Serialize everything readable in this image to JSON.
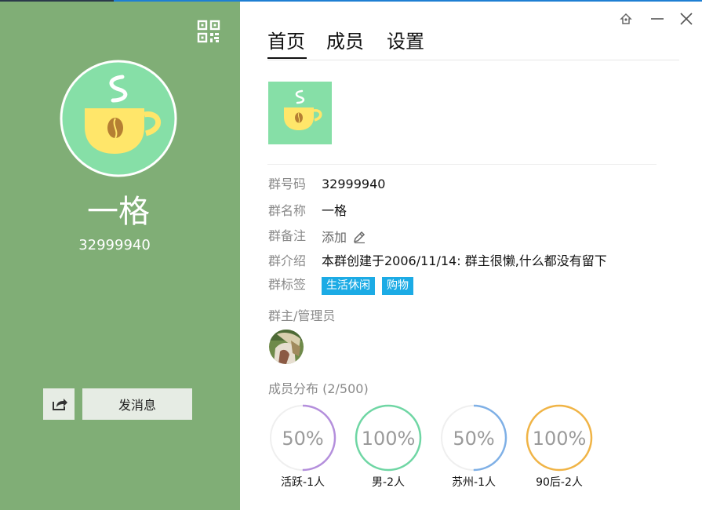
{
  "left_panel": {
    "group_name": "一格",
    "group_id": "32999940",
    "send_message_label": "发消息",
    "bg_color": "#80ae76"
  },
  "tabs": [
    {
      "label": "首页",
      "active": true
    },
    {
      "label": "成员",
      "active": false
    },
    {
      "label": "设置",
      "active": false
    }
  ],
  "info": {
    "id_label": "群号码",
    "id_value": "32999940",
    "name_label": "群名称",
    "name_value": "一格",
    "remark_label": "群备注",
    "remark_value": "添加",
    "intro_label": "群介绍",
    "intro_value": "本群创建于2006/11/14:  群主很懒,什么都没有留下",
    "tags_label": "群标签",
    "tags": [
      "生活休闲",
      "购物"
    ]
  },
  "admins_label": "群主/管理员",
  "distribution": {
    "label": "成员分布",
    "count": "(2/500)",
    "stats": [
      {
        "percent_text": "50%",
        "fraction": 0.5,
        "label": "活跃-1人",
        "color": "#b48fdc"
      },
      {
        "percent_text": "100%",
        "fraction": 1.0,
        "label": "男-2人",
        "color": "#6fd6a4"
      },
      {
        "percent_text": "50%",
        "fraction": 0.5,
        "label": "苏州-1人",
        "color": "#7fb0e6"
      },
      {
        "percent_text": "100%",
        "fraction": 1.0,
        "label": "90后-2人",
        "color": "#f0b446"
      }
    ]
  },
  "icons": {
    "qr": "qr-code-icon",
    "share": "share-icon",
    "edit": "pencil-icon",
    "window_skin": "skin-icon",
    "window_min": "minimize-icon",
    "window_close": "close-icon"
  }
}
